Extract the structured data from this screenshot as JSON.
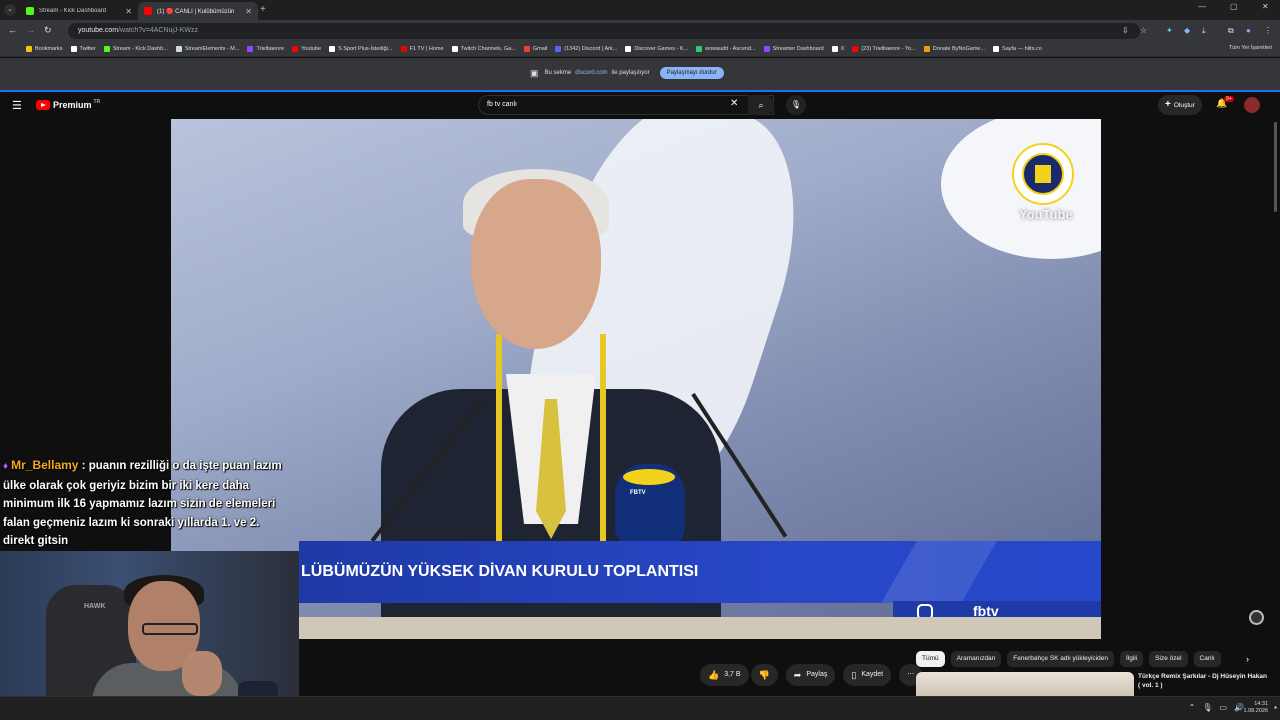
{
  "browser": {
    "tabs": [
      {
        "title": "Stream - Kick Dashboard",
        "favicon_color": "#53fc18"
      },
      {
        "title": "(1) 🔴 CANLI | Kulübümüzün",
        "favicon_color": "#ff0000"
      }
    ],
    "url_host": "youtube.com",
    "url_path": "/watch?v=4ACNujJ-KWzz",
    "bookmarks": [
      {
        "label": "Bookmarks",
        "color": "#f1c40f"
      },
      {
        "label": "Twitter",
        "color": "#ffffff"
      },
      {
        "label": "Stream - Kick Dashb...",
        "color": "#53fc18"
      },
      {
        "label": "StreamElements - M...",
        "color": "#cfd8dc"
      },
      {
        "label": "Trielbaenre",
        "color": "#9146ff"
      },
      {
        "label": "Youtube",
        "color": "#ff0000"
      },
      {
        "label": "S Sport Plus-İstediği...",
        "color": "#ffffff"
      },
      {
        "label": "F1 TV | Home",
        "color": "#e10600"
      },
      {
        "label": "Twitch Channels, Ga...",
        "color": "#ffffff"
      },
      {
        "label": "Gmail",
        "color": "#ea4335"
      },
      {
        "label": "(1342) Discord | Ark...",
        "color": "#5865f2"
      },
      {
        "label": "Discover Games - K...",
        "color": "#ffffff"
      },
      {
        "label": "wowaudit - Ascend...",
        "color": "#2ecc71"
      },
      {
        "label": "Streamer Dashboard",
        "color": "#9146ff"
      },
      {
        "label": "X",
        "color": "#ffffff"
      },
      {
        "label": "(23) Trielbaenre - Yo...",
        "color": "#ff0000"
      },
      {
        "label": "Donate ByNoGame...",
        "color": "#f39c12"
      },
      {
        "label": "Sayfa — hiits.co",
        "color": "#ffffff"
      }
    ],
    "bookmarks_right": "Tüm Yer İşaretleri"
  },
  "sharebar": {
    "prefix": "Bu sekme",
    "source": "discord.com",
    "suffix": "ile paylaşılıyor",
    "stop_label": "Paylaşmayı durdur"
  },
  "youtube": {
    "logo_text": "Premium",
    "region": "TR",
    "search_value": "fb tv canlı",
    "create_label": "Oluştur",
    "notification_count": "9+"
  },
  "video": {
    "banner_text": "LÜBÜMÜZÜN YÜKSEK DİVAN KURULU TOPLANTISI",
    "watermark": "YouTube",
    "channel_tag": "fbtv",
    "mic_label": "FBTV"
  },
  "chat": {
    "username": "Mr_Bellamy",
    "message": ": puanın rezilliği o da işte puan lazım ülke olarak çok geriyiz bizim bir iki kere daha minimum ilk 16 yapmamız lazım sizin de elemeleri falan geçmeniz lazım ki sonraki yıllarda 1. ve 2. direkt gitsin"
  },
  "webcam": {
    "chair_logo": "HAWK"
  },
  "actions": {
    "like_count": "3,7 B",
    "share_label": "Paylaş",
    "save_label": "Kaydet"
  },
  "chips": [
    "Tümü",
    "Aramanızdan",
    "Fenerbahçe SK adlı yükleyiciden",
    "İlgili",
    "Size özel",
    "Canlı"
  ],
  "recommendation": {
    "title": "Türkçe Remix Şarkılar - Dj Hüseyin Hakan ( vol. 1 )"
  },
  "taskbar": {
    "time": "14:31",
    "date": "1.08.2026"
  }
}
